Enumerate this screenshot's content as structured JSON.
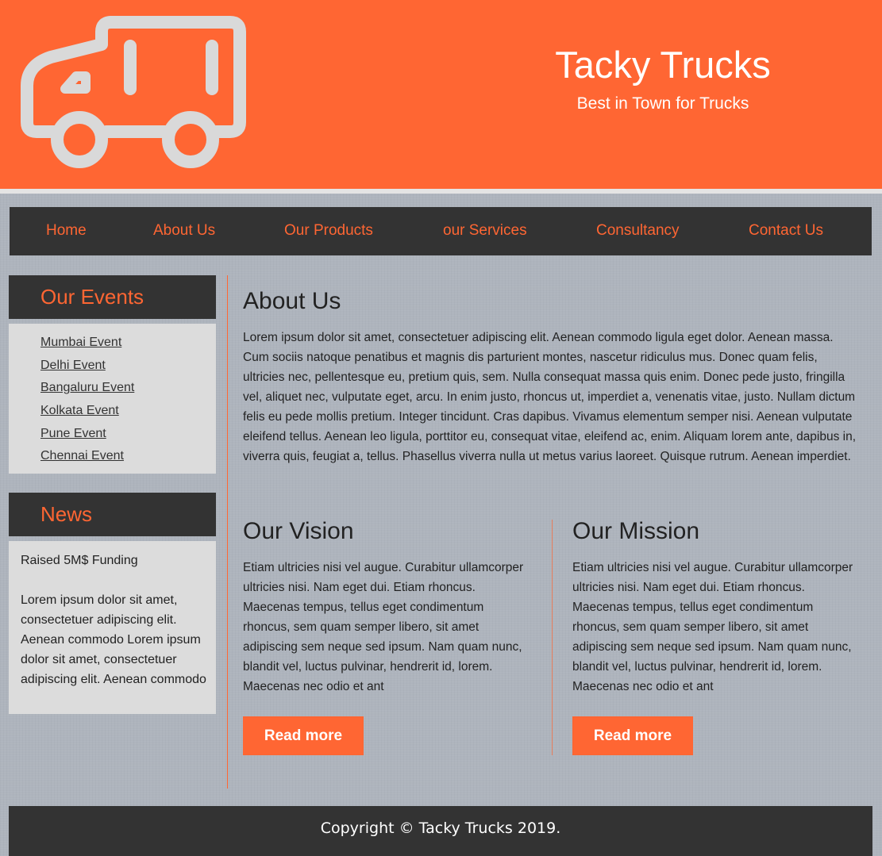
{
  "header": {
    "title": "Tacky Trucks",
    "tagline": "Best in Town for Trucks",
    "logo_icon": "truck-icon",
    "background_color": "#ff6633"
  },
  "nav": {
    "items": [
      "Home",
      "About Us",
      "Our Products",
      "our Services",
      "Consultancy",
      "Contact Us"
    ]
  },
  "sidebar": {
    "events": {
      "heading": "Our Events",
      "items": [
        "Mumbai Event",
        "Delhi Event",
        "Bangaluru Event",
        "Kolkata Event",
        "Pune Event",
        "Chennai Event"
      ]
    },
    "news": {
      "heading": "News",
      "title": "Raised 5M$ Funding",
      "body": "Lorem ipsum dolor sit amet, consectetuer adipiscing elit. Aenean commodo Lorem ipsum dolor sit amet, consectetuer adipiscing elit. Aenean commodo"
    }
  },
  "main": {
    "about": {
      "heading": "About Us",
      "text": "Lorem ipsum dolor sit amet, consectetuer adipiscing elit. Aenean commodo ligula eget dolor. Aenean massa. Cum sociis natoque penatibus et magnis dis parturient montes, nascetur ridiculus mus. Donec quam felis, ultricies nec, pellentesque eu, pretium quis, sem. Nulla consequat massa quis enim. Donec pede justo, fringilla vel, aliquet nec, vulputate eget, arcu. In enim justo, rhoncus ut, imperdiet a, venenatis vitae, justo. Nullam dictum felis eu pede mollis pretium. Integer tincidunt. Cras dapibus. Vivamus elementum semper nisi. Aenean vulputate eleifend tellus. Aenean leo ligula, porttitor eu, consequat vitae, eleifend ac, enim. Aliquam lorem ante, dapibus in, viverra quis, feugiat a, tellus. Phasellus viverra nulla ut metus varius laoreet. Quisque rutrum. Aenean imperdiet."
    },
    "vision": {
      "heading": "Our Vision",
      "text": "Etiam ultricies nisi vel augue. Curabitur ullamcorper ultricies nisi. Nam eget dui. Etiam rhoncus. Maecenas tempus, tellus eget condimentum rhoncus, sem quam semper libero, sit amet adipiscing sem neque sed ipsum. Nam quam nunc, blandit vel, luctus pulvinar, hendrerit id, lorem. Maecenas nec odio et ant",
      "button": "Read more"
    },
    "mission": {
      "heading": "Our Mission",
      "text": "Etiam ultricies nisi vel augue. Curabitur ullamcorper ultricies nisi. Nam eget dui. Etiam rhoncus. Maecenas tempus, tellus eget condimentum rhoncus, sem quam semper libero, sit amet adipiscing sem neque sed ipsum. Nam quam nunc, blandit vel, luctus pulvinar, hendrerit id, lorem. Maecenas nec odio et ant",
      "button": "Read more"
    }
  },
  "footer": {
    "copyright": "Copyright © Tacky Trucks 2019."
  },
  "colors": {
    "accent": "#ff6633",
    "dark": "#333333",
    "panel": "#dcdcdc"
  }
}
